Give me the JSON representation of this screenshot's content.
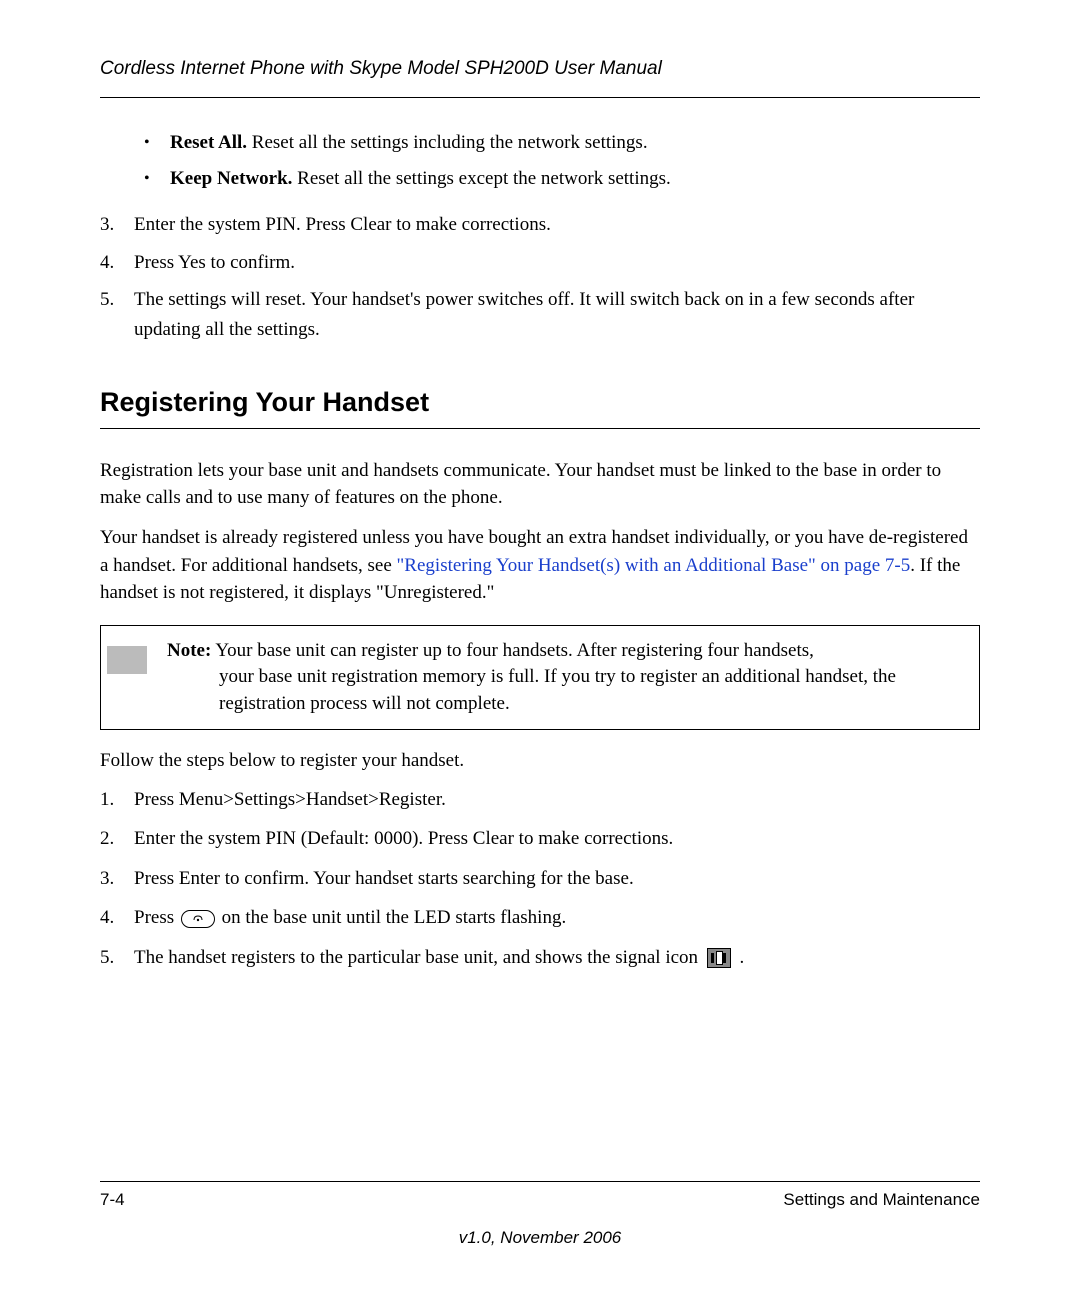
{
  "header": {
    "title": "Cordless Internet Phone with Skype Model SPH200D User Manual"
  },
  "top_bullets": [
    {
      "bold": "Reset All.",
      "text": " Reset all the settings including the network settings."
    },
    {
      "bold": "Keep Network.",
      "text": " Reset all the settings except the network settings."
    }
  ],
  "ol_continue": [
    "Enter the system PIN. Press Clear to make corrections.",
    "Press Yes to confirm.",
    "The settings will reset. Your handset's power switches off. It will switch back on in a few seconds after updating all the settings."
  ],
  "section_heading": "Registering Your Handset",
  "para1": "Registration lets your base unit and handsets communicate. Your handset must be linked to the base in order to make calls and to use many of features on the phone.",
  "para2_pre": "Your handset is already registered unless you have bought an extra handset individually, or you have de-registered a handset. For additional handsets, see ",
  "para2_link": "\"Registering Your Handset(s) with an Additional Base\" on page 7-5",
  "para2_post": ". If the handset is not registered, it displays \"Unregistered.\"",
  "note": {
    "label": "Note:",
    "rest_first_line": " Your base unit can register up to four handsets. After registering four handsets,",
    "rest_lines": "your base unit registration memory is full. If you try to register an additional handset, the registration process will not complete."
  },
  "follow_text": "Follow the steps below to register your handset.",
  "steps": {
    "s1": "Press Menu>Settings>Handset>Register.",
    "s2": "Enter the system PIN (Default: 0000). Press Clear to make corrections.",
    "s3": "Press Enter to confirm. Your handset starts searching for the base.",
    "s4_pre": "Press ",
    "s4_post": " on the base unit until the LED starts flashing.",
    "s5_pre": "The handset registers to the particular base unit, and shows the signal icon ",
    "s5_post": " ."
  },
  "footer": {
    "page_num": "7-4",
    "chapter": "Settings and Maintenance",
    "version": "v1.0, November 2006"
  }
}
